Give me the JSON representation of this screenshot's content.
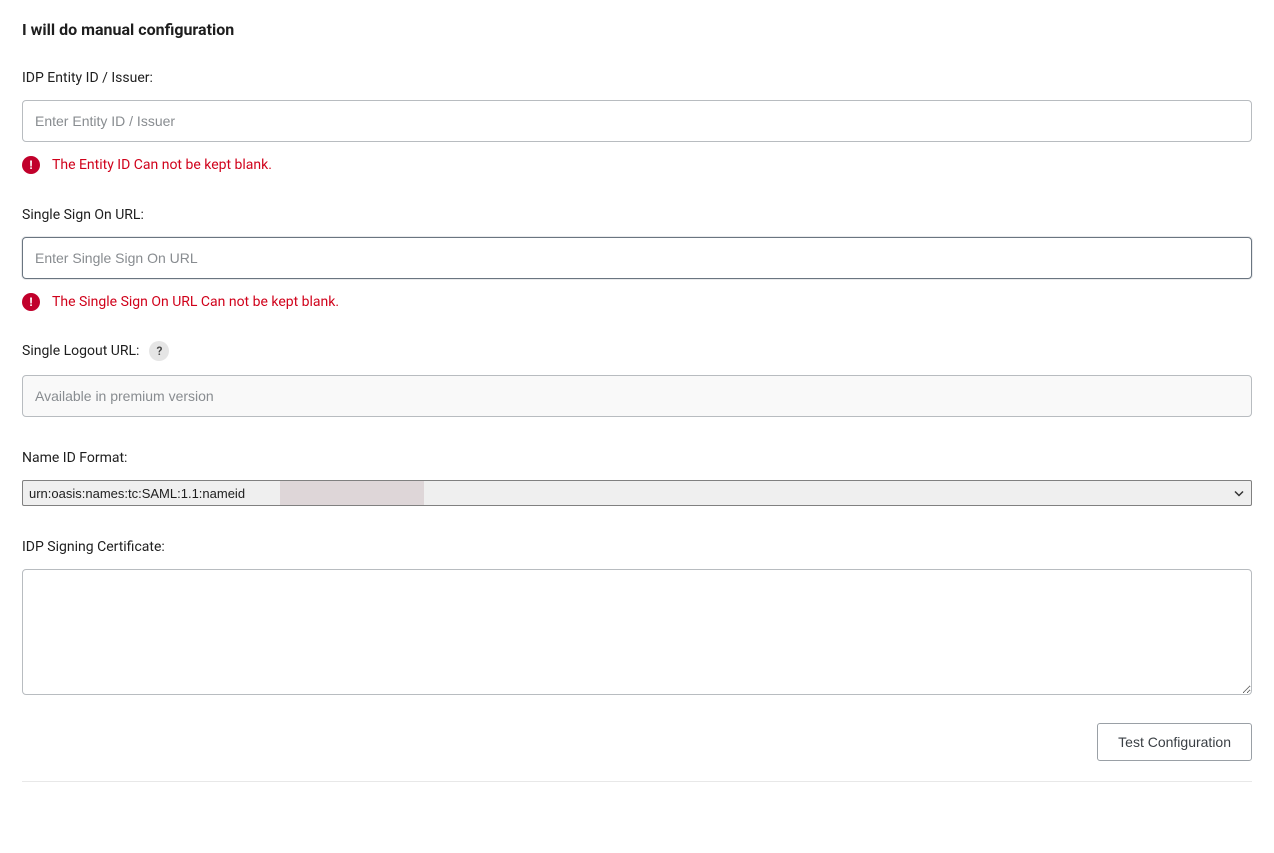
{
  "title": "I will do manual configuration",
  "fields": {
    "entity_id": {
      "label": "IDP Entity ID / Issuer:",
      "placeholder": "Enter Entity ID / Issuer",
      "value": "",
      "error": "The Entity ID Can not be kept blank."
    },
    "sso_url": {
      "label": "Single Sign On URL:",
      "placeholder": "Enter Single Sign On URL",
      "value": "",
      "error": "The Single Sign On URL Can not be kept blank."
    },
    "slo_url": {
      "label": "Single Logout URL:",
      "placeholder": "Available in premium version",
      "value": "",
      "help": "?"
    },
    "nameid_format": {
      "label": "Name ID Format:",
      "selected": "urn:oasis:names:tc:SAML:1.1:nameid"
    },
    "signing_cert": {
      "label": "IDP Signing Certificate:",
      "value": ""
    }
  },
  "buttons": {
    "test_configuration": "Test Configuration"
  }
}
